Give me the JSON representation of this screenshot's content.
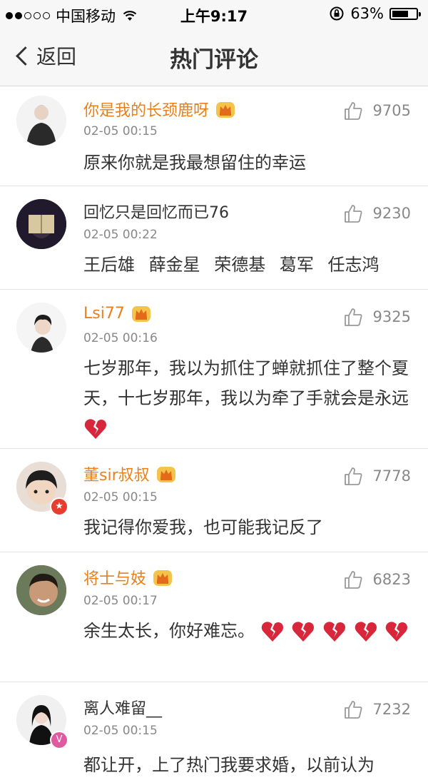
{
  "status_bar": {
    "carrier": "中国移动",
    "time": "上午9:17",
    "battery": "63%"
  },
  "nav": {
    "back_label": "返回",
    "title": "热门评论"
  },
  "comments": [
    {
      "name": "你是我的长颈鹿呀",
      "vip": true,
      "time": "02-05 00:15",
      "likes": "9705",
      "text": "原来你就是我最想留住的幸运",
      "hearts": 0
    },
    {
      "name": "回忆只是回忆而已76",
      "vip": false,
      "time": "02-05 00:22",
      "likes": "9230",
      "text": "王后雄 薛金星 荣德基 葛军 任志鸿",
      "hearts": 0
    },
    {
      "name": "Lsi77",
      "vip": true,
      "time": "02-05 00:16",
      "likes": "9325",
      "text": "七岁那年，我以为抓住了蝉就抓住了整个夏天，十七岁那年，我以为牵了手就会是永远",
      "hearts": 1
    },
    {
      "name": "董sir叔叔",
      "vip": true,
      "time": "02-05 00:15",
      "likes": "7778",
      "text": "我记得你爱我，也可能我记反了",
      "hearts": 0,
      "badge": "star"
    },
    {
      "name": "将士与妓",
      "vip": true,
      "time": "02-05 00:17",
      "likes": "6823",
      "text": "余生太长，你好难忘。",
      "hearts": 5
    },
    {
      "name": "离人难留__",
      "vip": false,
      "time": "02-05 00:15",
      "likes": "7232",
      "text": "都让开，上了热门我要求婚，以前认为",
      "hearts": 0,
      "badge": "v"
    }
  ],
  "colors": {
    "vip_name": "#e8801c",
    "badge_star": "#e63d2e",
    "badge_v": "#e05aa0"
  }
}
